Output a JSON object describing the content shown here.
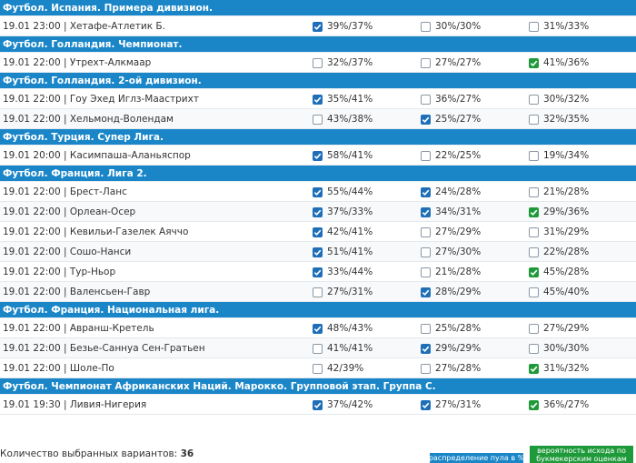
{
  "sections": [
    {
      "title": "Футбол. Испания. Примера дивизион.",
      "rows": [
        {
          "match": "19.01 23:00 | Хетафе-Атлетик Б.",
          "options": [
            {
              "value": "39%/37%",
              "checked": true
            },
            {
              "value": "30%/30%",
              "checked": false
            },
            {
              "value": "31%/33%",
              "checked": false
            }
          ]
        }
      ]
    },
    {
      "title": "Футбол. Голландия. Чемпионат.",
      "rows": [
        {
          "match": "19.01 22:00 | Утрехт-Алкмаар",
          "options": [
            {
              "value": "32%/37%",
              "checked": false
            },
            {
              "value": "27%/27%",
              "checked": false
            },
            {
              "value": "41%/36%",
              "checked": true
            }
          ]
        }
      ]
    },
    {
      "title": "Футбол. Голландия. 2-ой дивизион.",
      "rows": [
        {
          "match": "19.01 22:00 | Гоу Эхед Иглз-Маастрихт",
          "options": [
            {
              "value": "35%/41%",
              "checked": true
            },
            {
              "value": "36%/27%",
              "checked": false
            },
            {
              "value": "30%/32%",
              "checked": false
            }
          ]
        },
        {
          "match": "19.01 22:00 | Хельмонд-Волендам",
          "options": [
            {
              "value": "43%/38%",
              "checked": false
            },
            {
              "value": "25%/27%",
              "checked": true
            },
            {
              "value": "32%/35%",
              "checked": false
            }
          ]
        }
      ]
    },
    {
      "title": "Футбол. Турция. Супер Лига.",
      "rows": [
        {
          "match": "19.01 20:00 | Касимпаша-Аланьяспор",
          "options": [
            {
              "value": "58%/41%",
              "checked": true
            },
            {
              "value": "22%/25%",
              "checked": false
            },
            {
              "value": "19%/34%",
              "checked": false
            }
          ]
        }
      ]
    },
    {
      "title": "Футбол. Франция. Лига 2.",
      "rows": [
        {
          "match": "19.01 22:00 | Брест-Ланс",
          "options": [
            {
              "value": "55%/44%",
              "checked": true
            },
            {
              "value": "24%/28%",
              "checked": true
            },
            {
              "value": "21%/28%",
              "checked": false
            }
          ]
        },
        {
          "match": "19.01 22:00 | Орлеан-Осер",
          "options": [
            {
              "value": "37%/33%",
              "checked": true
            },
            {
              "value": "34%/31%",
              "checked": true
            },
            {
              "value": "29%/36%",
              "checked": true
            }
          ]
        },
        {
          "match": "19.01 22:00 | Кевильи-Газелек Аяччо",
          "options": [
            {
              "value": "42%/41%",
              "checked": true
            },
            {
              "value": "27%/29%",
              "checked": false
            },
            {
              "value": "31%/29%",
              "checked": false
            }
          ]
        },
        {
          "match": "19.01 22:00 | Сошо-Нанси",
          "options": [
            {
              "value": "51%/41%",
              "checked": true
            },
            {
              "value": "27%/30%",
              "checked": false
            },
            {
              "value": "22%/28%",
              "checked": false
            }
          ]
        },
        {
          "match": "19.01 22:00 | Тур-Ньор",
          "options": [
            {
              "value": "33%/44%",
              "checked": true
            },
            {
              "value": "21%/28%",
              "checked": false
            },
            {
              "value": "45%/28%",
              "checked": true
            }
          ]
        },
        {
          "match": "19.01 22:00 | Валенсьен-Гавр",
          "options": [
            {
              "value": "27%/31%",
              "checked": false
            },
            {
              "value": "28%/29%",
              "checked": true
            },
            {
              "value": "45%/40%",
              "checked": false
            }
          ]
        }
      ]
    },
    {
      "title": "Футбол. Франция. Национальная лига.",
      "rows": [
        {
          "match": "19.01 22:00 | Авранш-Кретель",
          "options": [
            {
              "value": "48%/43%",
              "checked": true
            },
            {
              "value": "25%/28%",
              "checked": false
            },
            {
              "value": "27%/29%",
              "checked": false
            }
          ]
        },
        {
          "match": "19.01 22:00 | Безье-Саннуа Сен-Гратьен",
          "options": [
            {
              "value": "41%/41%",
              "checked": false
            },
            {
              "value": "29%/29%",
              "checked": true
            },
            {
              "value": "30%/30%",
              "checked": false
            }
          ]
        },
        {
          "match": "19.01 22:00 | Шоле-По",
          "options": [
            {
              "value": "42/39%",
              "checked": false
            },
            {
              "value": "27%/28%",
              "checked": false
            },
            {
              "value": "31%/32%",
              "checked": true
            }
          ]
        }
      ]
    },
    {
      "title": "Футбол. Чемпионат Африканских Наций. Марокко. Групповой этап. Группа С.",
      "rows": [
        {
          "match": "19.01 19:30 | Ливия-Нигерия",
          "options": [
            {
              "value": "37%/42%",
              "checked": true
            },
            {
              "value": "27%/31%",
              "checked": true
            },
            {
              "value": "36%/27%",
              "checked": true
            }
          ]
        }
      ]
    }
  ],
  "footer": {
    "count_label": "Количество выбранных вариантов:",
    "count_value": "36",
    "legend_pool": "распределение пула в %",
    "legend_prob": "вероятность исхода по букмекерским оценкам"
  },
  "colors": {
    "header_bg": "#1a86c8",
    "checked_blue": "#1e6fb8",
    "checked_green": "#1e9a3a"
  }
}
